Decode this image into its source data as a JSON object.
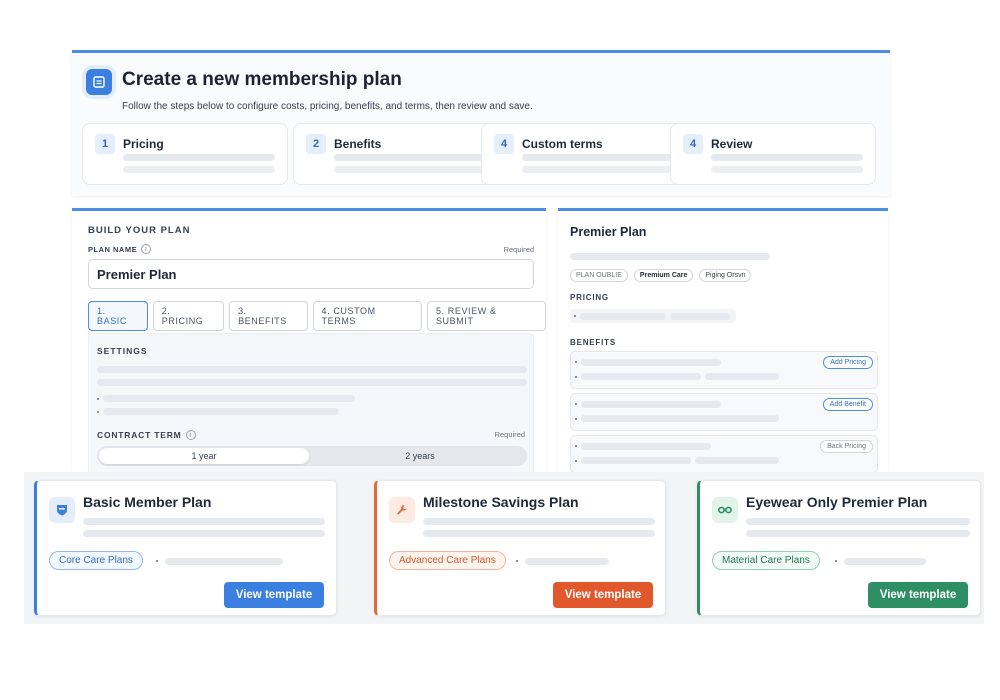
{
  "header": {
    "title": "Create a new membership plan",
    "subtitle": "Follow the steps below to configure costs, pricing, benefits, and terms, then review and save.",
    "steps": [
      {
        "num": "1",
        "label": "Pricing"
      },
      {
        "num": "2",
        "label": "Benefits"
      },
      {
        "num": "4",
        "label": "Custom terms"
      },
      {
        "num": "4",
        "label": "Review"
      }
    ]
  },
  "build": {
    "title": "BUILD YOUR PLAN",
    "plan_name_label": "PLAN NAME",
    "required": "Required",
    "plan_name_value": "Premier Plan",
    "tabs": [
      "1. BASIC",
      "2. PRICING",
      "3. BENEFITS",
      "4. CUSTOM TERMS",
      "5. REVIEW & SUBMIT"
    ],
    "settings_title": "SETTINGS",
    "contract_term_label": "CONTRACT TERM",
    "contract_required": "Required",
    "term_options": [
      "1 year",
      "2 years"
    ]
  },
  "preview": {
    "title": "Premier Plan",
    "chips": [
      "PLAN OUBLIE",
      "Premium Care",
      "Piging Orsvn"
    ],
    "pricing_label": "PRICING",
    "benefits_label": "BENEFITS",
    "benefit_buttons": [
      "Add Pricing",
      "Add Benefit",
      "Back Pricing"
    ]
  },
  "templates": [
    {
      "title": "Basic Member Plan",
      "badge": "Core Care Plans",
      "button": "View template",
      "icon": "shield-icon"
    },
    {
      "title": "Milestone Savings Plan",
      "badge": "Advanced Care Plans",
      "button": "View template",
      "icon": "wrench-icon"
    },
    {
      "title": "Eyewear Only Premier Plan",
      "badge": "Material Care Plans",
      "button": "View template",
      "icon": "glasses-icon"
    }
  ],
  "colors": {
    "accent_blue": "#3b7fe1",
    "accent_orange": "#e1582c",
    "accent_green": "#2e8f64"
  }
}
